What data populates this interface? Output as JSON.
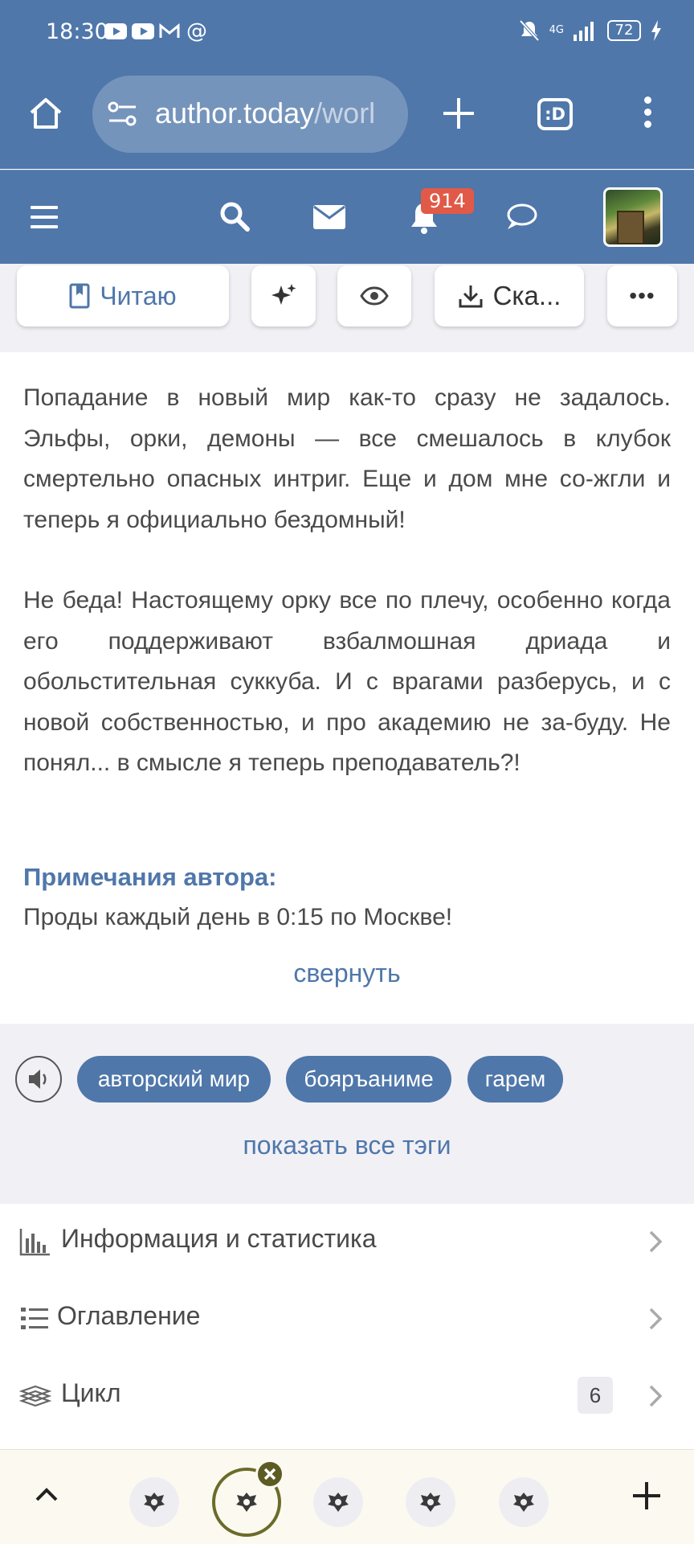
{
  "status": {
    "time": "18:30",
    "network": "4G",
    "battery": "72"
  },
  "browser": {
    "url_host": "author.today",
    "url_path": "/worl",
    "tabs_label": ":D"
  },
  "header": {
    "notifications_count": "914"
  },
  "actions": {
    "read_label": "Читаю",
    "download_label": "Ска...",
    "more_label": "•••"
  },
  "annotation": {
    "paragraph1": "Попадание в новый мир как-то сразу не задалось. Эльфы, орки, демоны — все смешалось в клубок смертельно опасных интриг. Еще и дом мне со-жгли и теперь я официально бездомный!",
    "paragraph2": "Не беда! Настоящему орку все по плечу, особенно когда его поддерживают взбалмошная дриада и обольстительная суккуба. И с врагами разберусь, и с новой собственностью, и про академию не за-буду. Не понял... в смысле я теперь преподаватель?!",
    "notes_title": "Примечания автора:",
    "notes_text": "Проды каждый день в 0:15 по Москве!",
    "collapse": "свернуть"
  },
  "tags": {
    "items": [
      "авторский мир",
      "бояръаниме",
      "гарем"
    ],
    "show_all": "показать все тэги"
  },
  "menu": {
    "info": "Информация и статистика",
    "toc": "Оглавление",
    "series": "Цикл",
    "series_count": "6"
  },
  "colors": {
    "brand": "#4f77aa",
    "badge": "#e05a47",
    "background_alt": "#f1f0f5"
  }
}
